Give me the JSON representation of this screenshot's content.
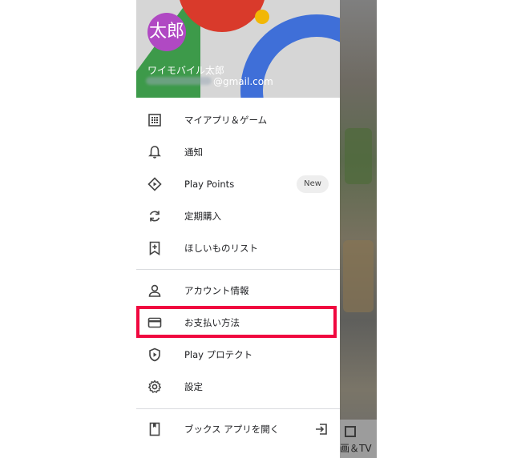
{
  "header": {
    "avatar_text": "太郎",
    "user_name": "ワイモバイル太郎",
    "email_suffix": "@gmail.com"
  },
  "menu": [
    {
      "label": "マイアプリ＆ゲーム",
      "icon": "apps-grid-icon"
    },
    {
      "label": "通知",
      "icon": "bell-icon"
    },
    {
      "label": "Play Points",
      "icon": "play-points-icon",
      "badge": "New"
    },
    {
      "label": "定期購入",
      "icon": "refresh-icon"
    },
    {
      "label": "ほしいものリスト",
      "icon": "bookmark-add-icon"
    },
    {
      "label": "アカウント情報",
      "icon": "person-icon"
    },
    {
      "label": "お支払い方法",
      "icon": "credit-card-icon"
    },
    {
      "label": "Play プロテクト",
      "icon": "shield-play-icon"
    },
    {
      "label": "設定",
      "icon": "gear-icon"
    },
    {
      "label": "ブックス アプリを開く",
      "icon": "book-icon",
      "trailing_icon": "open-app-icon"
    }
  ],
  "background_app": {
    "bottom_tab_label": "画＆TV",
    "tab_icon": "movie-icon"
  },
  "highlight": {
    "target": "お支払い方法",
    "color": "#f0083f"
  }
}
